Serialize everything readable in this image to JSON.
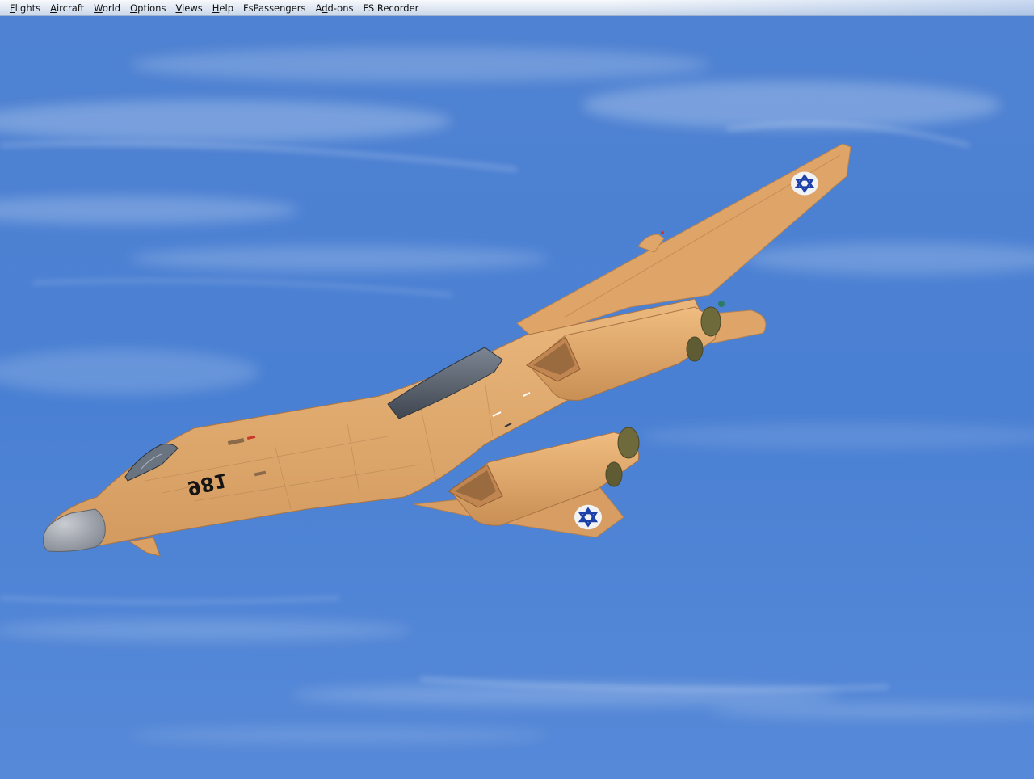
{
  "menubar": {
    "items": [
      {
        "label": "Flights",
        "mnemonic": "F",
        "rest": "lights"
      },
      {
        "label": "Aircraft",
        "mnemonic": "A",
        "rest": "ircraft"
      },
      {
        "label": "World",
        "mnemonic": "W",
        "rest": "orld"
      },
      {
        "label": "Options",
        "mnemonic": "O",
        "rest": "ptions"
      },
      {
        "label": "Views",
        "mnemonic": "V",
        "rest": "iews"
      },
      {
        "label": "Help",
        "mnemonic": "H",
        "rest": "elp"
      },
      {
        "label": "FsPassengers",
        "mnemonic": "",
        "rest": "FsPassengers"
      },
      {
        "label": "Add-ons",
        "mnemonic": "d",
        "pre": "A",
        "rest": "d-ons"
      },
      {
        "label": "FS Recorder",
        "mnemonic": "",
        "rest": "FS Recorder"
      }
    ]
  },
  "scene": {
    "aircraft_marking": "981",
    "aircraft_color": "#e2a86c",
    "sky_color_top": "#4d83d4",
    "sky_color_bottom": "#5487d6",
    "roundel_color": "#1c3fa8"
  }
}
